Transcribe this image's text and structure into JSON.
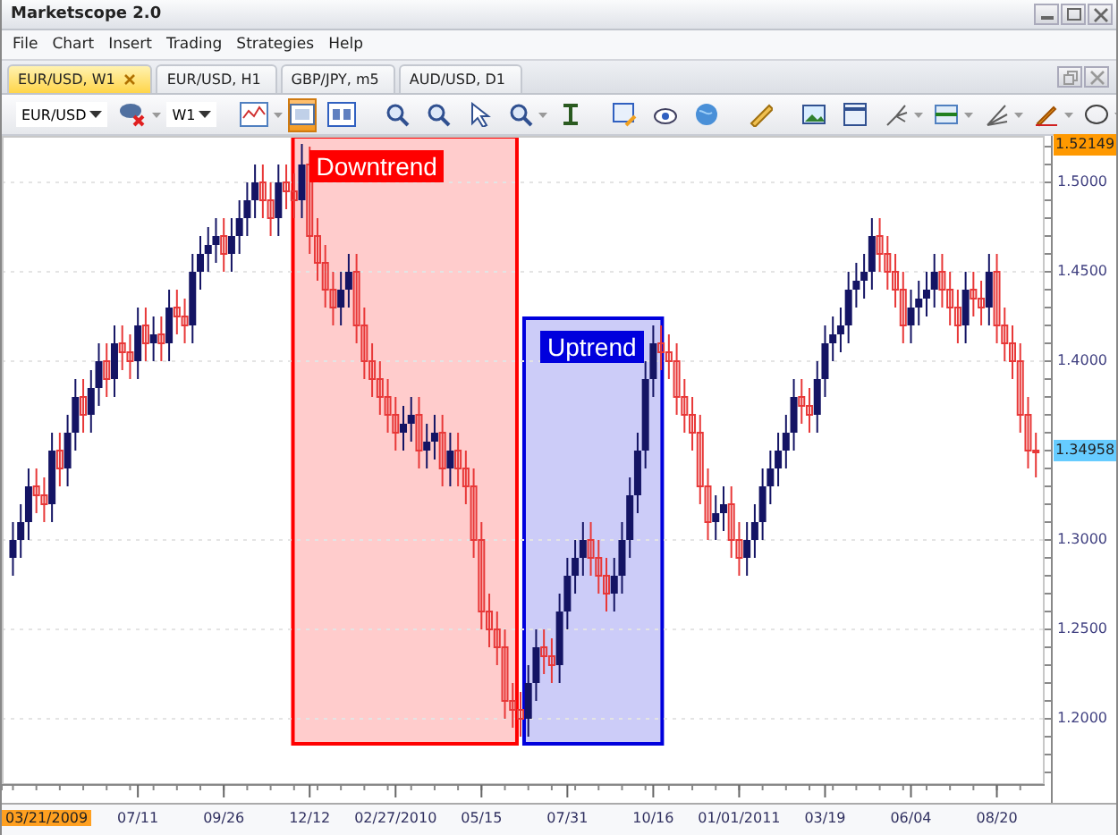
{
  "window": {
    "title": "Marketscope 2.0"
  },
  "menu": [
    "File",
    "Chart",
    "Insert",
    "Trading",
    "Strategies",
    "Help"
  ],
  "tabs": [
    {
      "label": "EUR/USD, W1",
      "selected": true
    },
    {
      "label": "EUR/USD, H1",
      "selected": false
    },
    {
      "label": "GBP/JPY, m5",
      "selected": false
    },
    {
      "label": "AUD/USD, D1",
      "selected": false
    }
  ],
  "toolbar": {
    "symbol": "EUR/USD",
    "timeframe": "W1",
    "panel_toggle_on": true
  },
  "chart": {
    "zones": [
      {
        "kind": "down",
        "label": "Downtrend",
        "color": "#ff0000"
      },
      {
        "kind": "up",
        "label": "Uptrend",
        "color": "#0000dd"
      }
    ],
    "tags": [
      {
        "color": "#ffa020"
      },
      {
        "color": "#ff9900"
      },
      {
        "color": "#66ccff"
      }
    ],
    "chart_data": {
      "type": "candlestick",
      "grid": true,
      "xlim": [
        "2009-03-11",
        "2011-12-05"
      ],
      "ylim": [
        1.164,
        1.526
      ],
      "yticks": [
        {
          "value": 1.2,
          "label": "1.2000"
        },
        {
          "value": 1.25,
          "label": "1.2500"
        },
        {
          "value": 1.3,
          "label": "1.3000"
        },
        {
          "value": 1.4,
          "label": "1.4000"
        },
        {
          "value": 1.45,
          "label": "1.4500"
        },
        {
          "value": 1.5,
          "label": "1.5000"
        }
      ],
      "xticks": [
        {
          "value": "2009-07-11",
          "label": "07/11"
        },
        {
          "value": "2009-09-26",
          "label": "09/26"
        },
        {
          "value": "2009-12-12",
          "label": "12/12"
        },
        {
          "value": "2010-02-27",
          "label": "02/27/2010"
        },
        {
          "value": "2010-05-15",
          "label": "05/15"
        },
        {
          "value": "2010-07-31",
          "label": "07/31"
        },
        {
          "value": "2010-10-16",
          "label": "10/16"
        },
        {
          "value": "2011-01-01",
          "label": "01/01/2011"
        },
        {
          "value": "2011-03-19",
          "label": "03/19"
        },
        {
          "value": "2011-06-04",
          "label": "06/04"
        },
        {
          "value": "2011-08-20",
          "label": "08/20"
        }
      ],
      "x": [
        "2009-03-21",
        "2009-03-28",
        "2009-04-04",
        "2009-04-11",
        "2009-04-18",
        "2009-04-25",
        "2009-05-02",
        "2009-05-09",
        "2009-05-16",
        "2009-05-23",
        "2009-05-30",
        "2009-06-06",
        "2009-06-13",
        "2009-06-20",
        "2009-06-27",
        "2009-07-04",
        "2009-07-11",
        "2009-07-18",
        "2009-07-25",
        "2009-08-01",
        "2009-08-08",
        "2009-08-15",
        "2009-08-22",
        "2009-08-29",
        "2009-09-05",
        "2009-09-12",
        "2009-09-19",
        "2009-09-26",
        "2009-10-03",
        "2009-10-10",
        "2009-10-17",
        "2009-10-24",
        "2009-10-31",
        "2009-11-07",
        "2009-11-14",
        "2009-11-21",
        "2009-11-28",
        "2009-12-05",
        "2009-12-12",
        "2009-12-19",
        "2009-12-26",
        "2010-01-02",
        "2010-01-09",
        "2010-01-16",
        "2010-01-23",
        "2010-01-30",
        "2010-02-06",
        "2010-02-13",
        "2010-02-20",
        "2010-02-27",
        "2010-03-06",
        "2010-03-13",
        "2010-03-20",
        "2010-03-27",
        "2010-04-03",
        "2010-04-10",
        "2010-04-17",
        "2010-04-24",
        "2010-05-01",
        "2010-05-08",
        "2010-05-15",
        "2010-05-22",
        "2010-05-29",
        "2010-06-05",
        "2010-06-12",
        "2010-06-19",
        "2010-06-26",
        "2010-07-03",
        "2010-07-10",
        "2010-07-17",
        "2010-07-24",
        "2010-07-31",
        "2010-08-07",
        "2010-08-14",
        "2010-08-21",
        "2010-08-28",
        "2010-09-04",
        "2010-09-11",
        "2010-09-18",
        "2010-09-25",
        "2010-10-02",
        "2010-10-09",
        "2010-10-16",
        "2010-10-23",
        "2010-10-30",
        "2010-11-06",
        "2010-11-13",
        "2010-11-20",
        "2010-11-27",
        "2010-12-04",
        "2010-12-11",
        "2010-12-18",
        "2010-12-25",
        "2011-01-01",
        "2011-01-08",
        "2011-01-15",
        "2011-01-22",
        "2011-01-29",
        "2011-02-05",
        "2011-02-12",
        "2011-02-19",
        "2011-02-26",
        "2011-03-05",
        "2011-03-12",
        "2011-03-19",
        "2011-03-26",
        "2011-04-02",
        "2011-04-09",
        "2011-04-16",
        "2011-04-23",
        "2011-04-30",
        "2011-05-07",
        "2011-05-14",
        "2011-05-21",
        "2011-05-28",
        "2011-06-04",
        "2011-06-11",
        "2011-06-18",
        "2011-06-25",
        "2011-07-02",
        "2011-07-09",
        "2011-07-16",
        "2011-07-23",
        "2011-07-30",
        "2011-08-06",
        "2011-08-13",
        "2011-08-20",
        "2011-08-27",
        "2011-09-03",
        "2011-09-10",
        "2011-09-17",
        "2011-09-24"
      ],
      "ohlc": [
        [
          1.29,
          1.31,
          1.28,
          1.3
        ],
        [
          1.3,
          1.32,
          1.29,
          1.31
        ],
        [
          1.31,
          1.34,
          1.3,
          1.33
        ],
        [
          1.33,
          1.34,
          1.315,
          1.325
        ],
        [
          1.325,
          1.335,
          1.31,
          1.32
        ],
        [
          1.32,
          1.36,
          1.31,
          1.35
        ],
        [
          1.35,
          1.36,
          1.33,
          1.34
        ],
        [
          1.34,
          1.37,
          1.33,
          1.36
        ],
        [
          1.36,
          1.39,
          1.35,
          1.38
        ],
        [
          1.38,
          1.39,
          1.36,
          1.37
        ],
        [
          1.37,
          1.395,
          1.36,
          1.385
        ],
        [
          1.385,
          1.41,
          1.375,
          1.4
        ],
        [
          1.4,
          1.41,
          1.38,
          1.39
        ],
        [
          1.39,
          1.42,
          1.38,
          1.41
        ],
        [
          1.41,
          1.42,
          1.395,
          1.405
        ],
        [
          1.405,
          1.415,
          1.39,
          1.4
        ],
        [
          1.4,
          1.43,
          1.39,
          1.42
        ],
        [
          1.42,
          1.43,
          1.4,
          1.41
        ],
        [
          1.41,
          1.425,
          1.4,
          1.415
        ],
        [
          1.415,
          1.425,
          1.4,
          1.41
        ],
        [
          1.41,
          1.44,
          1.4,
          1.43
        ],
        [
          1.43,
          1.44,
          1.415,
          1.425
        ],
        [
          1.425,
          1.435,
          1.41,
          1.42
        ],
        [
          1.42,
          1.46,
          1.41,
          1.45
        ],
        [
          1.45,
          1.47,
          1.44,
          1.46
        ],
        [
          1.46,
          1.475,
          1.45,
          1.465
        ],
        [
          1.465,
          1.48,
          1.455,
          1.47
        ],
        [
          1.47,
          1.48,
          1.45,
          1.46
        ],
        [
          1.46,
          1.48,
          1.45,
          1.47
        ],
        [
          1.47,
          1.49,
          1.46,
          1.48
        ],
        [
          1.48,
          1.5,
          1.47,
          1.49
        ],
        [
          1.49,
          1.51,
          1.48,
          1.5
        ],
        [
          1.5,
          1.51,
          1.48,
          1.49
        ],
        [
          1.49,
          1.5,
          1.47,
          1.48
        ],
        [
          1.48,
          1.51,
          1.47,
          1.5
        ],
        [
          1.5,
          1.51,
          1.485,
          1.495
        ],
        [
          1.495,
          1.505,
          1.48,
          1.49
        ],
        [
          1.49,
          1.5215,
          1.48,
          1.51
        ],
        [
          1.51,
          1.52,
          1.46,
          1.47
        ],
        [
          1.47,
          1.48,
          1.445,
          1.455
        ],
        [
          1.455,
          1.465,
          1.43,
          1.44
        ],
        [
          1.44,
          1.45,
          1.42,
          1.43
        ],
        [
          1.43,
          1.45,
          1.42,
          1.44
        ],
        [
          1.44,
          1.46,
          1.43,
          1.45
        ],
        [
          1.45,
          1.46,
          1.41,
          1.42
        ],
        [
          1.42,
          1.43,
          1.39,
          1.4
        ],
        [
          1.4,
          1.41,
          1.38,
          1.39
        ],
        [
          1.39,
          1.4,
          1.37,
          1.38
        ],
        [
          1.38,
          1.39,
          1.36,
          1.37
        ],
        [
          1.37,
          1.38,
          1.35,
          1.36
        ],
        [
          1.36,
          1.375,
          1.35,
          1.365
        ],
        [
          1.365,
          1.38,
          1.355,
          1.37
        ],
        [
          1.37,
          1.38,
          1.34,
          1.35
        ],
        [
          1.35,
          1.365,
          1.34,
          1.355
        ],
        [
          1.355,
          1.37,
          1.345,
          1.36
        ],
        [
          1.36,
          1.37,
          1.33,
          1.34
        ],
        [
          1.34,
          1.36,
          1.33,
          1.35
        ],
        [
          1.35,
          1.36,
          1.33,
          1.34
        ],
        [
          1.34,
          1.35,
          1.32,
          1.33
        ],
        [
          1.33,
          1.34,
          1.29,
          1.3
        ],
        [
          1.3,
          1.31,
          1.25,
          1.26
        ],
        [
          1.26,
          1.27,
          1.24,
          1.25
        ],
        [
          1.25,
          1.26,
          1.23,
          1.24
        ],
        [
          1.24,
          1.25,
          1.2,
          1.21
        ],
        [
          1.21,
          1.22,
          1.195,
          1.205
        ],
        [
          1.205,
          1.215,
          1.19,
          1.2
        ],
        [
          1.2,
          1.23,
          1.19,
          1.22
        ],
        [
          1.22,
          1.25,
          1.21,
          1.24
        ],
        [
          1.24,
          1.25,
          1.225,
          1.235
        ],
        [
          1.235,
          1.245,
          1.22,
          1.23
        ],
        [
          1.23,
          1.27,
          1.22,
          1.26
        ],
        [
          1.26,
          1.29,
          1.25,
          1.28
        ],
        [
          1.28,
          1.3,
          1.27,
          1.29
        ],
        [
          1.29,
          1.31,
          1.28,
          1.3
        ],
        [
          1.3,
          1.31,
          1.28,
          1.29
        ],
        [
          1.29,
          1.3,
          1.27,
          1.28
        ],
        [
          1.28,
          1.29,
          1.26,
          1.27
        ],
        [
          1.27,
          1.29,
          1.26,
          1.28
        ],
        [
          1.28,
          1.31,
          1.27,
          1.3
        ],
        [
          1.3,
          1.335,
          1.29,
          1.325
        ],
        [
          1.325,
          1.36,
          1.315,
          1.35
        ],
        [
          1.35,
          1.4,
          1.34,
          1.39
        ],
        [
          1.39,
          1.42,
          1.38,
          1.41
        ],
        [
          1.41,
          1.42,
          1.395,
          1.405
        ],
        [
          1.405,
          1.415,
          1.39,
          1.4
        ],
        [
          1.4,
          1.41,
          1.37,
          1.38
        ],
        [
          1.38,
          1.39,
          1.36,
          1.37
        ],
        [
          1.37,
          1.38,
          1.35,
          1.36
        ],
        [
          1.36,
          1.37,
          1.32,
          1.33
        ],
        [
          1.33,
          1.34,
          1.3,
          1.31
        ],
        [
          1.31,
          1.325,
          1.3,
          1.315
        ],
        [
          1.315,
          1.33,
          1.305,
          1.32
        ],
        [
          1.32,
          1.33,
          1.29,
          1.3
        ],
        [
          1.3,
          1.31,
          1.28,
          1.29
        ],
        [
          1.29,
          1.31,
          1.28,
          1.3
        ],
        [
          1.3,
          1.32,
          1.29,
          1.31
        ],
        [
          1.31,
          1.34,
          1.3,
          1.33
        ],
        [
          1.33,
          1.35,
          1.32,
          1.34
        ],
        [
          1.34,
          1.36,
          1.33,
          1.35
        ],
        [
          1.35,
          1.37,
          1.34,
          1.36
        ],
        [
          1.36,
          1.39,
          1.35,
          1.38
        ],
        [
          1.38,
          1.39,
          1.365,
          1.375
        ],
        [
          1.375,
          1.385,
          1.36,
          1.37
        ],
        [
          1.37,
          1.4,
          1.36,
          1.39
        ],
        [
          1.39,
          1.42,
          1.38,
          1.41
        ],
        [
          1.41,
          1.425,
          1.4,
          1.415
        ],
        [
          1.415,
          1.43,
          1.405,
          1.42
        ],
        [
          1.42,
          1.45,
          1.41,
          1.44
        ],
        [
          1.44,
          1.455,
          1.43,
          1.445
        ],
        [
          1.445,
          1.46,
          1.435,
          1.45
        ],
        [
          1.45,
          1.48,
          1.44,
          1.47
        ],
        [
          1.47,
          1.48,
          1.45,
          1.46
        ],
        [
          1.46,
          1.47,
          1.44,
          1.45
        ],
        [
          1.45,
          1.46,
          1.43,
          1.44
        ],
        [
          1.44,
          1.45,
          1.41,
          1.42
        ],
        [
          1.42,
          1.44,
          1.41,
          1.43
        ],
        [
          1.43,
          1.445,
          1.42,
          1.435
        ],
        [
          1.435,
          1.45,
          1.425,
          1.44
        ],
        [
          1.44,
          1.46,
          1.43,
          1.45
        ],
        [
          1.45,
          1.46,
          1.43,
          1.44
        ],
        [
          1.44,
          1.45,
          1.42,
          1.43
        ],
        [
          1.43,
          1.44,
          1.41,
          1.42
        ],
        [
          1.42,
          1.45,
          1.41,
          1.44
        ],
        [
          1.44,
          1.45,
          1.425,
          1.435
        ],
        [
          1.435,
          1.445,
          1.42,
          1.43
        ],
        [
          1.43,
          1.46,
          1.42,
          1.45
        ],
        [
          1.45,
          1.46,
          1.41,
          1.42
        ],
        [
          1.42,
          1.43,
          1.4,
          1.41
        ],
        [
          1.41,
          1.42,
          1.39,
          1.4
        ],
        [
          1.4,
          1.41,
          1.36,
          1.37
        ],
        [
          1.37,
          1.38,
          1.34,
          1.35
        ],
        [
          1.35,
          1.36,
          1.335,
          1.3496
        ]
      ],
      "annotations": [
        "03/21/2009",
        "1.52149",
        "1.34958"
      ]
    }
  }
}
